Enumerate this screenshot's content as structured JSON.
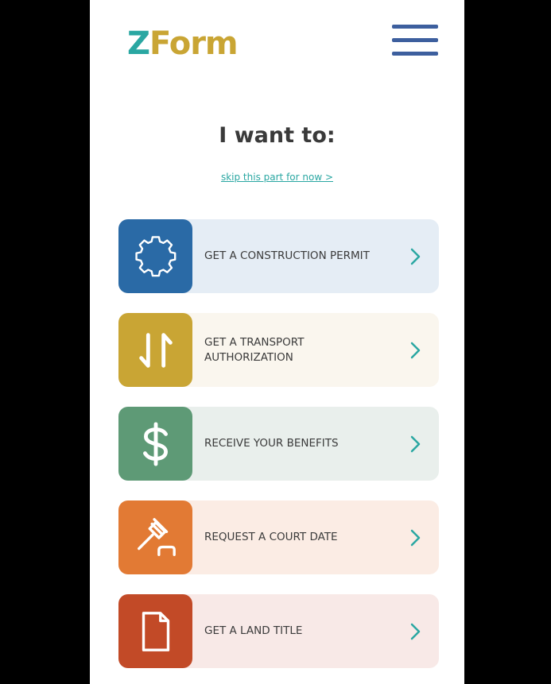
{
  "header": {
    "logo_z": "Z",
    "logo_rest": "Form",
    "logo_colors": {
      "z": "#2aa7a2",
      "rest": "#c9a534"
    },
    "menu_icon": "hamburger-menu-icon"
  },
  "main": {
    "heading": "I want to:",
    "skip_link": "skip this part for now >",
    "options": [
      {
        "label": "GET A CONSTRUCTION PERMIT",
        "icon": "gear-icon",
        "icon_color": "#2a6aa6",
        "bg_color": "#e5edf5"
      },
      {
        "label": "GET A TRANSPORT\nAUTHORIZATION",
        "icon": "transfer-arrows-icon",
        "icon_color": "#c9a534",
        "bg_color": "#faf6ee"
      },
      {
        "label": "RECEIVE YOUR BENEFITS",
        "icon": "dollar-icon",
        "icon_color": "#5e9a76",
        "bg_color": "#e9efec"
      },
      {
        "label": "REQUEST A COURT DATE",
        "icon": "gavel-icon",
        "icon_color": "#e27a34",
        "bg_color": "#fbece4"
      },
      {
        "label": "GET A LAND TITLE",
        "icon": "document-icon",
        "icon_color": "#c24a27",
        "bg_color": "#f8e9e7"
      }
    ],
    "chevron_icon": "chevron-right-icon",
    "chevron_color": "#2aa7a2"
  }
}
